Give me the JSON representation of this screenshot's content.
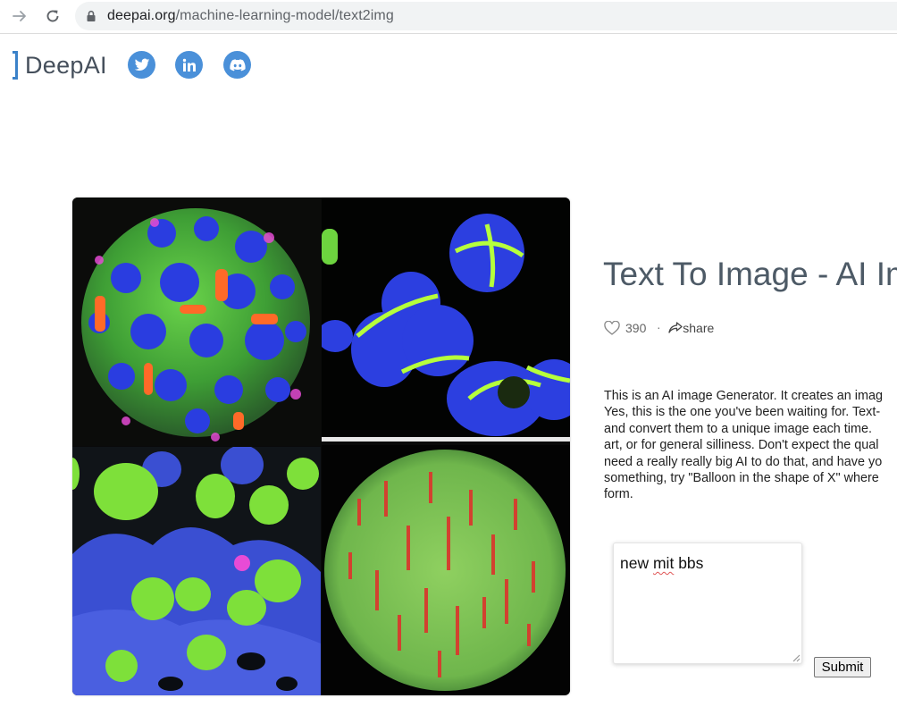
{
  "browser": {
    "url_host": "deepai.org",
    "url_path": "/machine-learning-model/text2img"
  },
  "header": {
    "logo_text": "DeepAI",
    "social": [
      "twitter-icon",
      "linkedin-icon",
      "discord-icon"
    ]
  },
  "main": {
    "title": "Text To Image - AI Im",
    "likes": "390",
    "share_label": "share",
    "description_lines": [
      "This is an AI image Generator. It creates an imag",
      "Yes, this is the one you've been waiting for. Text-",
      "and convert them to a unique image each time.",
      "art, or for general silliness. Don't expect the qual",
      "need a really really big AI to do that, and have yo",
      "something, try \"Balloon in the shape of X\" where",
      "form."
    ],
    "prompt": {
      "word1": "new",
      "word2": "mit",
      "word3": "bbs"
    },
    "submit_label": "Submit"
  },
  "colors": {
    "accent": "#3b82c9",
    "social_bg": "#4a90d9",
    "title": "#4d5a66"
  }
}
